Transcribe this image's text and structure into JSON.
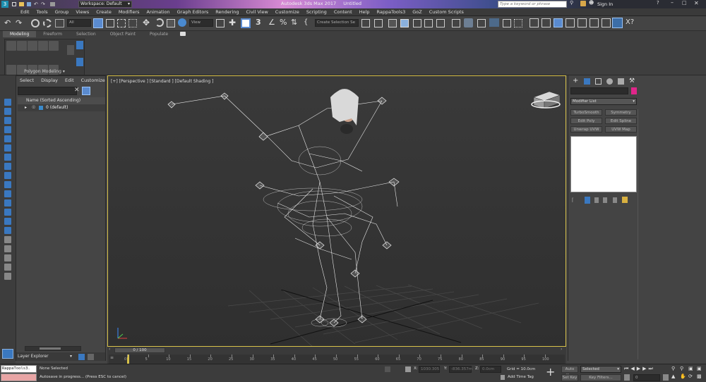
{
  "app": {
    "title_center": "Autodesk 3ds Max 2017",
    "title_doc": "Untitled",
    "workspace_label": "Workspace: Default",
    "search_placeholder": "Type a keyword or phrase",
    "sign_in": "Sign In",
    "logo_text": "3"
  },
  "menu": [
    "Edit",
    "Tools",
    "Group",
    "Views",
    "Create",
    "Modifiers",
    "Animation",
    "Graph Editors",
    "Rendering",
    "Civil View",
    "Customize",
    "Scripting",
    "Content",
    "Help",
    "RappaTools3",
    "GoZ",
    "Custom Scripts"
  ],
  "toolbar": {
    "filter_select": "All",
    "view_select": "View",
    "selection_set": "Create Selection Se"
  },
  "ribbon": {
    "tabs": [
      "Modeling",
      "Freeform",
      "Selection",
      "Object Paint",
      "Populate"
    ],
    "active_tab": "Modeling",
    "panel_label": "Polygon Modeling ▾"
  },
  "explorer": {
    "menu": [
      "Select",
      "Display",
      "Edit",
      "Customize"
    ],
    "column_header": "Name (Sorted Ascending)",
    "tree_item": "0 (default)",
    "footer_label": "Layer Explorer"
  },
  "viewport": {
    "label": "[+] [Perspective ] [Standard ] [Default Shading ]"
  },
  "cmdpanel": {
    "modifier_list": "Modifier List",
    "buttons": [
      "TurboSmooth",
      "Symmetry",
      "Edit Poly",
      "Edit Spline",
      "Unwrap UVW",
      "UVW Map"
    ],
    "color_swatch": "#e0268a"
  },
  "timeline": {
    "frame_display": "0 / 100",
    "ticks": [
      "0",
      "5",
      "10",
      "15",
      "20",
      "25",
      "30",
      "35",
      "40",
      "45",
      "50",
      "55",
      "60",
      "65",
      "70",
      "75",
      "80",
      "85",
      "90",
      "95",
      "100"
    ]
  },
  "status": {
    "maxscript_box": "RappaTools3.",
    "selected": "None Selected",
    "autosave": "Autosave in progress... (Press ESC to cancel)",
    "x_label": "X:",
    "x_value": "1030.305",
    "y_label": "Y:",
    "y_value": "-836.357m",
    "z_label": "Z:",
    "z_value": "0.0cm",
    "grid": "Grid = 10.0cm",
    "add_time_tag": "Add Time Tag",
    "auto_key": "Auto Key",
    "auto_key_select": "Selected",
    "set_key": "Set Key",
    "key_filters": "Key Filters...",
    "frame_field": "0"
  }
}
